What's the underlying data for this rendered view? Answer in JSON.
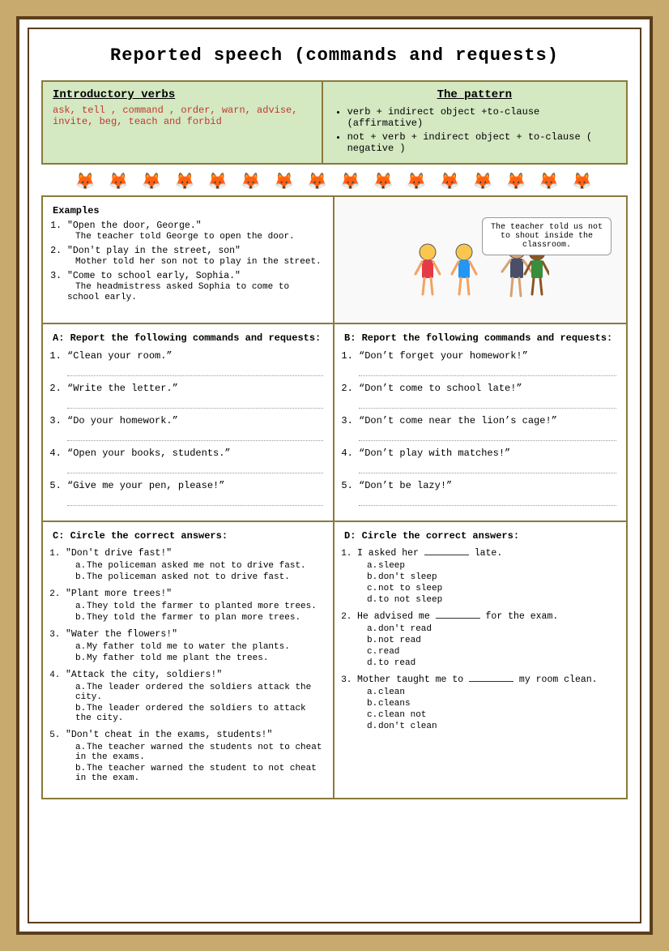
{
  "page": {
    "title": "Reported speech (commands and requests)",
    "intro": {
      "left_heading": "Introductory verbs",
      "left_content": "ask, tell , command , order, warn, advise, invite, beg, teach and forbid",
      "right_heading": "The pattern",
      "pattern1": "verb + indirect object +to-clause (affirmative)",
      "pattern2": "not + verb + indirect object + to-clause ( negative )"
    },
    "fox_divider": "🦊 🦊 🦊 🦊 🦊 🦊 🦊 🦊 🦊 🦊 🦊 🦊 🦊 🦊 🦊 🦊",
    "examples_heading": "Examples",
    "examples": [
      {
        "direct": "“Open the door, George.”",
        "reported": "The teacher told George to open the door."
      },
      {
        "direct": "“Don't play in the street, son”",
        "reported": "Mother told her son not to play in the street."
      },
      {
        "direct": "“Come to school early, Sophia.”",
        "reported": "The headmistress asked Sophia to come to school early."
      }
    ],
    "speech_bubble_text": "The teacher told us not to shout inside the classroom.",
    "section_a": {
      "heading": "A: Report the following commands and requests:",
      "questions": [
        "“Clean your room.”",
        "“Write the letter.”",
        "“Do your homework.”",
        "“Open your books, students.”",
        "“Give me your pen, please!”"
      ]
    },
    "section_b": {
      "heading": "B: Report the following commands and requests:",
      "questions": [
        "“Don’t forget your homework!”",
        "“Don’t come to school late!”",
        "“Don’t come near the lion’s cage!”",
        "“Don’t play with matches!”",
        "“Don’t be lazy!”"
      ]
    },
    "section_c": {
      "heading": "C: Circle the correct answers:",
      "questions": [
        {
          "text": "“Don’t drive fast!”",
          "options": [
            "The policeman asked me not to drive fast.",
            "The policeman asked not to drive fast."
          ]
        },
        {
          "text": "“Plant more trees!”",
          "options": [
            "They told the farmer to planted more trees.",
            "They told the farmer to plan more trees."
          ]
        },
        {
          "text": "“Water the flowers!”",
          "options": [
            "My father told me to water the plants.",
            "My father told me plant the trees."
          ]
        },
        {
          "text": "“Attack the city, soldiers!”",
          "options": [
            "The leader ordered the soldiers attack the city.",
            "The leader ordered the soldiers to attack the city."
          ]
        },
        {
          "text": "“Don’t cheat in the exams, students!”",
          "options": [
            "The teacher warned the students not to cheat in the exams.",
            "The teacher warned the student to not cheat in the exam."
          ]
        }
      ]
    },
    "section_d": {
      "heading": "D: Circle the correct answers:",
      "questions": [
        {
          "text": "I asked her _______ late.",
          "options": [
            "sleep",
            "don't sleep",
            "not to sleep",
            "to not sleep"
          ]
        },
        {
          "text": "He advised me _______ for the exam.",
          "options": [
            "don't read",
            "not read",
            "read",
            "to read"
          ]
        },
        {
          "text": "Mother taught me to _______ my room clean.",
          "options": [
            "clean",
            "cleans",
            "clean not",
            "don't clean"
          ]
        }
      ]
    }
  }
}
